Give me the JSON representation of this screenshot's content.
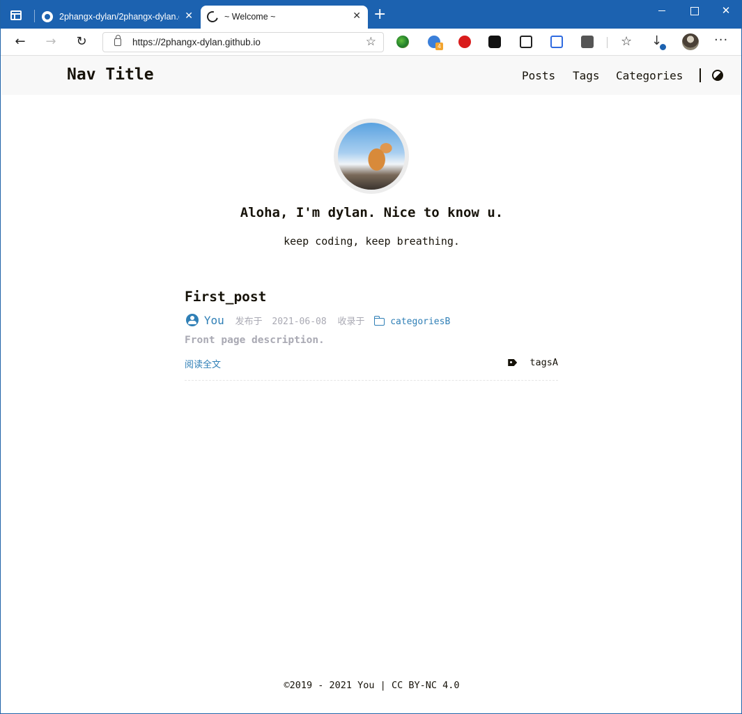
{
  "browser": {
    "tabs": [
      {
        "title": "2phangx-dylan/2phangx-dylan.g",
        "favicon": "github-icon",
        "close": "✕",
        "active": false
      },
      {
        "title": "~ Welcome ~",
        "favicon": "moon-icon",
        "close": "✕",
        "active": true
      }
    ],
    "new_tab": "+",
    "window_close": "✕",
    "url": "https://2phangx-dylan.github.io",
    "nav_icons": {
      "back": "←",
      "forward": "→",
      "reload": "↻",
      "favorite": "☆",
      "favorites": "☆",
      "downloads": "↓",
      "menu": "···"
    },
    "extension_badge": "4"
  },
  "site": {
    "brand": "Nav Title",
    "menu": [
      "Posts",
      "Tags",
      "Categories"
    ],
    "greeting": "Aloha, I'm dylan. Nice to know u.",
    "motto": "keep coding, keep breathing."
  },
  "post": {
    "title": "First_post",
    "author": "You",
    "published_label": "发布于",
    "date": "2021-06-08",
    "category_label": "收录于",
    "category": "categoriesB",
    "description": "Front page description.",
    "read_more": "阅读全文",
    "tag": "tagsA"
  },
  "footer": {
    "text": "©2019 - 2021 You | CC BY-NC 4.0"
  },
  "colors": {
    "titlebar": "#1c62b0",
    "link": "#2f7fb6",
    "text": "#161209",
    "muted": "#a9a9b3",
    "header_bg": "#f8f8f8"
  }
}
